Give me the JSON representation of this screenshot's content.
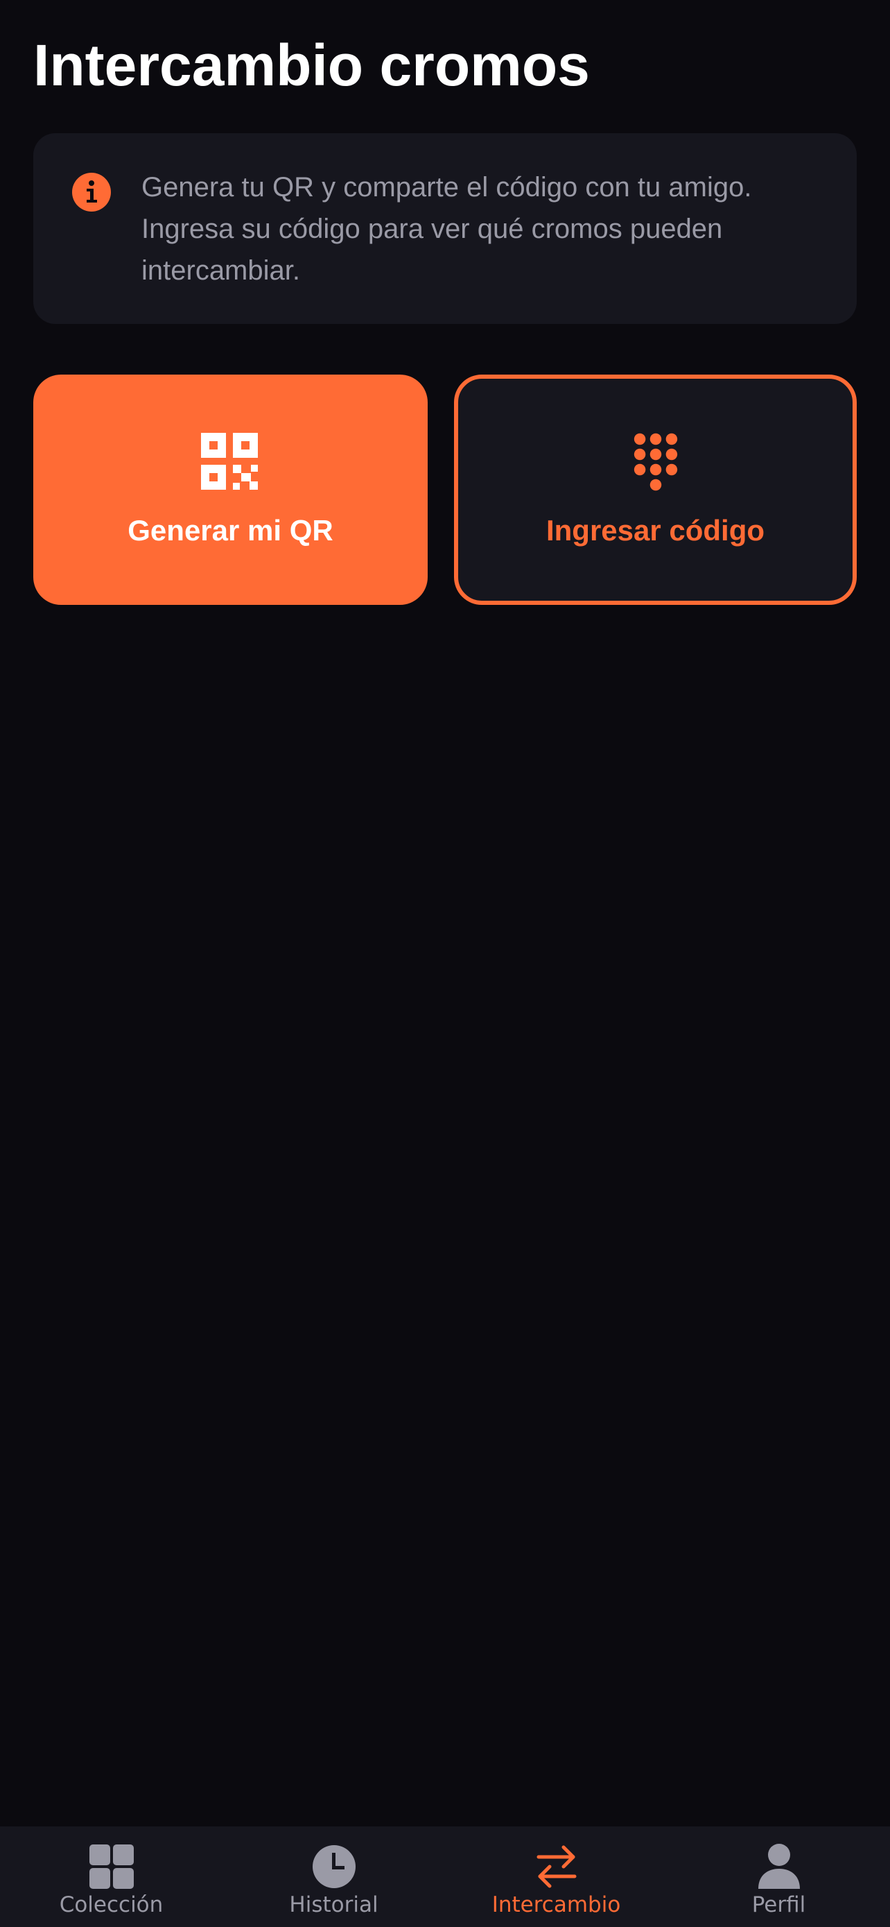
{
  "header": {
    "title": "Intercambio cromos"
  },
  "info": {
    "icon": "info-icon",
    "text": "Genera tu QR y comparte el código con tu amigo. Ingresa su código para ver qué cromos pueden intercambiar."
  },
  "actions": {
    "generate": {
      "label": "Generar mi QR",
      "icon": "qr-code-icon"
    },
    "enter_code": {
      "label": "Ingresar código",
      "icon": "keypad-icon"
    }
  },
  "tabbar": {
    "active": "Intercambio",
    "items": [
      {
        "label": "Colección",
        "icon": "grid-icon"
      },
      {
        "label": "Historial",
        "icon": "clock-icon"
      },
      {
        "label": "Intercambio",
        "icon": "swap-arrows-icon"
      },
      {
        "label": "Perfil",
        "icon": "person-icon"
      }
    ]
  },
  "colors": {
    "background": "#0b0a0f",
    "card": "#16161e",
    "accent": "#ff6b35",
    "muted_text": "#9a9aa6",
    "title_text": "#ffffff"
  }
}
